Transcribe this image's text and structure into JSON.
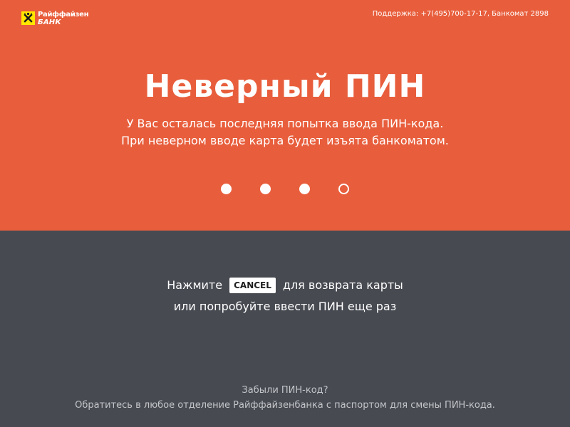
{
  "header": {
    "logo": {
      "line1": "Райффайзен",
      "line2": "БАНК",
      "icon": "raiffeisen-logo-icon",
      "color": "#ffe600"
    },
    "support_text": "Поддержка: +7(495)700-17-17, Банкомат 2898"
  },
  "error": {
    "title": "Неверный ПИН",
    "message_line1": "У Вас осталась последняя попытка ввода ПИН-кода.",
    "message_line2": "При неверном вводе карта будет изъята банкоматом."
  },
  "pin_indicator": {
    "total": 4,
    "filled": 3
  },
  "instructions": {
    "line1_before": "Нажмите",
    "cancel_key": "CANCEL",
    "line1_after": "для возврата карты",
    "line2": "или попробуйте ввести ПИН еще раз"
  },
  "footer": {
    "line1": "Забыли ПИН-код?",
    "line2": "Обратитесь в любое отделение Райффайзенбанка с паспортом для смены ПИН-кода."
  },
  "colors": {
    "top_background": "#e85e3c",
    "bottom_background": "#474a51",
    "text": "#ffffff",
    "footer_text": "#c3c5c9"
  }
}
